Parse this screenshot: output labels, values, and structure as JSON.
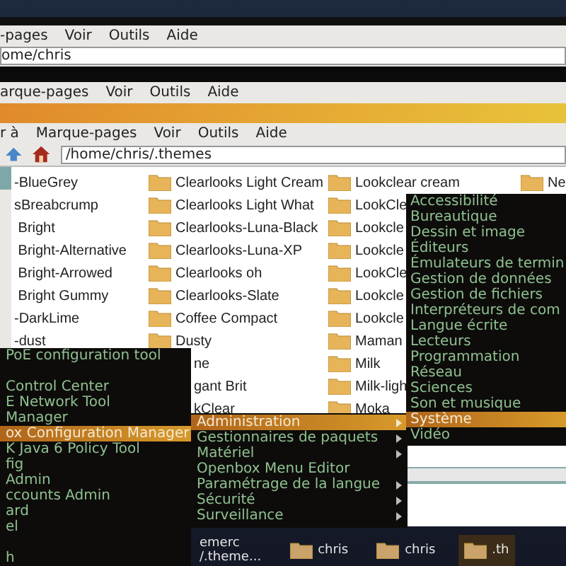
{
  "back_window": {
    "menubar": [
      "-pages",
      "Voir",
      "Outils",
      "Aide"
    ],
    "address": "ome/chris"
  },
  "middle_window": {
    "menubar": [
      "arque-pages",
      "Voir",
      "Outils",
      "Aide"
    ]
  },
  "file_manager": {
    "menubar": [
      "r à",
      "Marque-pages",
      "Voir",
      "Outils",
      "Aide"
    ],
    "address": "/home/chris/.themes",
    "columns": [
      {
        "kind": "clipped",
        "items": [
          "-BlueGrey",
          "sBreabcrump",
          " Bright",
          " Bright-Alternative",
          " Bright-Arrowed",
          " Bright Gummy",
          "-DarkLime",
          "-dust"
        ]
      },
      {
        "kind": "folders",
        "items": [
          "Clearlooks Light Cream",
          "Clearlooks Light What",
          "Clearlooks-Luna-Black",
          "Clearlooks-Luna-XP",
          "Clearlooks oh",
          "Clearlooks-Slate",
          "Coffee Compact",
          "Dusty"
        ]
      },
      {
        "kind": "clipped",
        "items": [
          "ne",
          "gant Brit",
          "kClear"
        ]
      },
      {
        "kind": "folders",
        "items": [
          "Lookclear cream",
          "LookCle",
          "Lookcle",
          "Lookcle",
          "LookCle",
          "Lookcle",
          "Lookcle",
          "Maman",
          "Milk",
          "Milk-ligh",
          "Moka"
        ]
      },
      {
        "kind": "folders",
        "items": [
          "Ne"
        ]
      }
    ]
  },
  "left_menu": [
    {
      "kind": "item",
      "label": "PoE configuration tool",
      "selected": false
    },
    {
      "kind": "blank"
    },
    {
      "kind": "item",
      "label": "Control Center",
      "selected": false
    },
    {
      "kind": "item",
      "label": "E Network Tool",
      "selected": false
    },
    {
      "kind": "item",
      "label": "Manager",
      "selected": false
    },
    {
      "kind": "item",
      "label": "ox Configuration Manager",
      "selected": true
    },
    {
      "kind": "item",
      "label": "K Java 6 Policy Tool",
      "selected": false
    },
    {
      "kind": "item",
      "label": "fig",
      "selected": false
    },
    {
      "kind": "item",
      "label": "Admin",
      "selected": false
    },
    {
      "kind": "item",
      "label": "ccounts Admin",
      "selected": false
    },
    {
      "kind": "item",
      "label": "ard",
      "selected": false
    },
    {
      "kind": "item",
      "label": "el",
      "selected": false
    },
    {
      "kind": "blank"
    },
    {
      "kind": "item",
      "label": "h",
      "selected": false
    }
  ],
  "middle_menu": [
    {
      "label": "Administration",
      "selected": true,
      "submenu": true
    },
    {
      "label": "Gestionnaires de paquets",
      "selected": false,
      "submenu": true
    },
    {
      "label": "Matériel",
      "selected": false,
      "submenu": true
    },
    {
      "label": "Openbox Menu Editor",
      "selected": false,
      "submenu": false
    },
    {
      "label": "Paramétrage de la langue",
      "selected": false,
      "submenu": true
    },
    {
      "label": "Sécurité",
      "selected": false,
      "submenu": true
    },
    {
      "label": "Surveillance",
      "selected": false,
      "submenu": true
    }
  ],
  "right_menu": [
    {
      "label": "Accessibilité",
      "selected": false
    },
    {
      "label": "Bureautique",
      "selected": false
    },
    {
      "label": "Dessin et image",
      "selected": false
    },
    {
      "label": "Éditeurs",
      "selected": false
    },
    {
      "label": "Émulateurs de termin",
      "selected": false
    },
    {
      "label": "Gestion de données",
      "selected": false
    },
    {
      "label": "Gestion de fichiers",
      "selected": false
    },
    {
      "label": "Interpréteurs de com",
      "selected": false
    },
    {
      "label": "Langue écrite",
      "selected": false
    },
    {
      "label": "Lecteurs",
      "selected": false
    },
    {
      "label": "Programmation",
      "selected": false
    },
    {
      "label": "Réseau",
      "selected": false
    },
    {
      "label": "Sciences",
      "selected": false
    },
    {
      "label": "Son et musique",
      "selected": false
    },
    {
      "label": "Système",
      "selected": true
    },
    {
      "label": "Vidéo",
      "selected": false
    }
  ],
  "desktop_icons": [
    {
      "kind": "text",
      "lines": [
        "emerc",
        "/.theme..."
      ],
      "selected": false
    },
    {
      "kind": "folder",
      "lines": [
        "chris"
      ],
      "selected": false
    },
    {
      "kind": "folder",
      "lines": [
        "chris"
      ],
      "selected": false
    },
    {
      "kind": "folder",
      "lines": [
        ".th"
      ],
      "selected": true
    }
  ]
}
